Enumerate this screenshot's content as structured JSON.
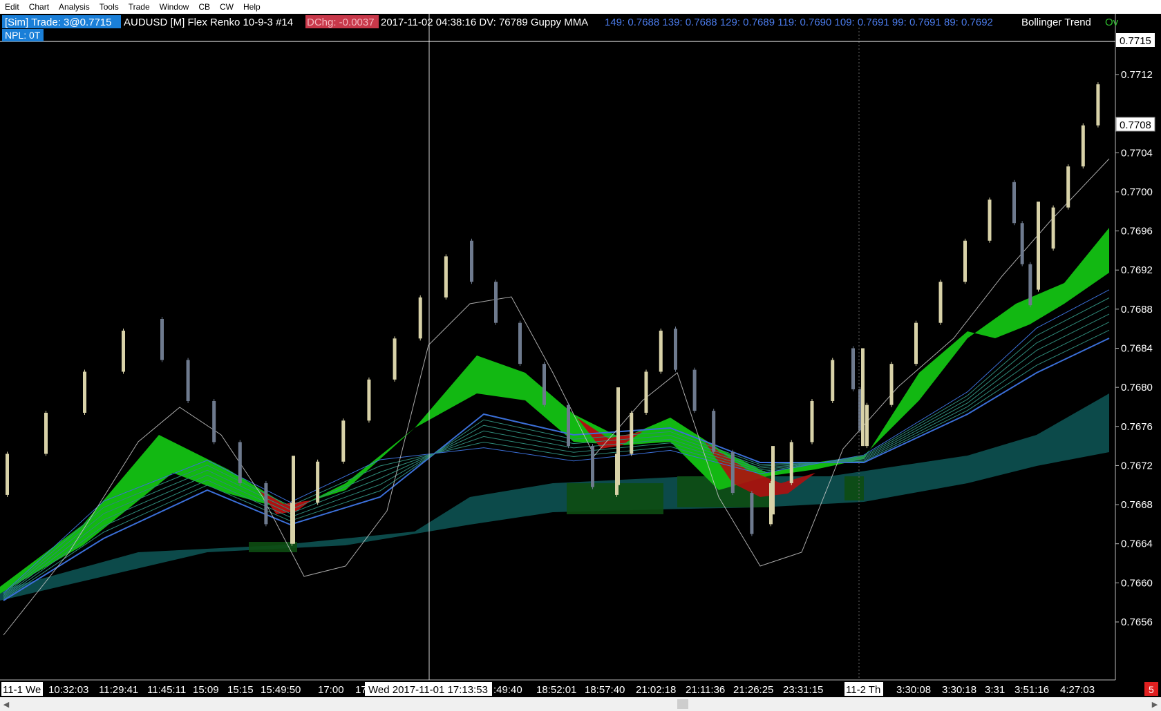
{
  "menu": [
    "Edit",
    "Chart",
    "Analysis",
    "Tools",
    "Trade",
    "Window",
    "CB",
    "CW",
    "Help"
  ],
  "header": {
    "sim_trade": "[Sim]  Trade: 3@0.7715",
    "instrument": "AUDUSD [M]  Flex Renko 10-9-3  #14",
    "dchg": "DChg: -0.0037",
    "info": "2017-11-02 04:38:16 DV: 76789  Guppy MMA",
    "guppy_values": "149: 0.7688  139: 0.7688  129: 0.7689  119: 0.7690  109: 0.7691  99: 0.7691  89: 0.7692",
    "bollinger": "Bollinger Trend",
    "bollinger_value": "Ov",
    "npl": "NPL: 0T"
  },
  "price_axis": {
    "ticks": [
      "0.7712",
      "0.7704",
      "0.7700",
      "0.7696",
      "0.7692",
      "0.7688",
      "0.7684",
      "0.7680",
      "0.7676",
      "0.7672",
      "0.7668",
      "0.7664",
      "0.7660",
      "0.7656"
    ],
    "tick_values": [
      0.7712,
      0.7704,
      0.77,
      0.7696,
      0.7692,
      0.7688,
      0.7684,
      0.768,
      0.7676,
      0.7672,
      0.7668,
      0.7664,
      0.766,
      0.7656
    ],
    "trade_label": "0.7715",
    "trade_value": 0.7715,
    "last_label": "0.7708",
    "last_value": 0.7708
  },
  "time_axis": {
    "labels": [
      "11-1 We",
      "10:32:03",
      "11:29:41",
      "11:45:11",
      "15:09",
      "15:15",
      "15:49:50",
      "17:00",
      "17",
      ":49:40",
      "18:52:01",
      "18:57:40",
      "21:02:18",
      "21:11:36",
      "21:26:25",
      "23:31:15",
      "11-2 Th",
      "3:30:08",
      "3:30:18",
      "3:31",
      "3:51:16",
      "4:27:03"
    ],
    "crosshair_label": "Wed 2017-11-01  17:13:53",
    "corner_badge": "5"
  },
  "colors": {
    "up_candle": "#d8d2a8",
    "down_candle": "#6e7a8e",
    "guppy_short": "#12b812",
    "guppy_red": "#b01010",
    "guppy_long_line": "#3b6fd8",
    "bollinger_band": "#0c4a4a",
    "background": "#000000",
    "sim_bg": "#1a7fd8",
    "dchg_bg": "#c8384a"
  }
}
